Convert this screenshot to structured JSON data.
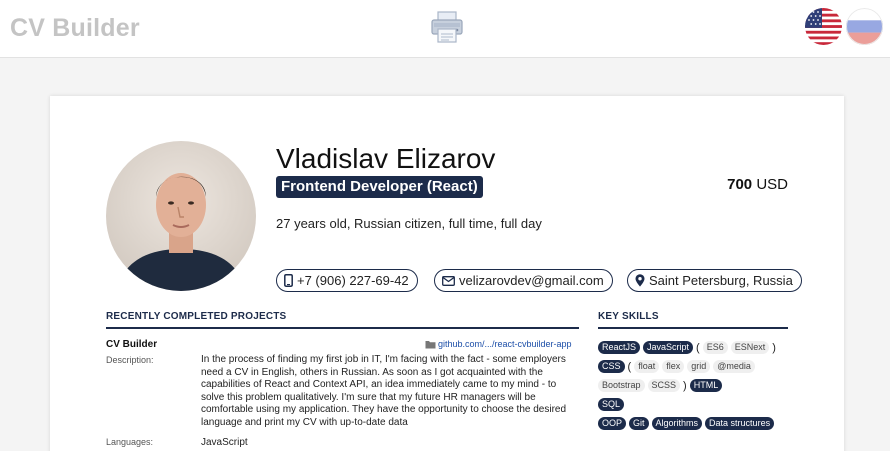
{
  "header": {
    "brand": "CV Builder",
    "print_icon": "printer-icon",
    "languages": [
      {
        "code": "en",
        "icon": "us-flag-icon",
        "active": true
      },
      {
        "code": "ru",
        "icon": "russia-flag-icon",
        "active": false
      }
    ]
  },
  "profile": {
    "name": "Vladislav Elizarov",
    "position": "Frontend Developer (React)",
    "salary_amount": "700",
    "salary_currency": "USD",
    "about": "27 years old, Russian citizen, full time, full day"
  },
  "contacts": {
    "phone": "+7 (906) 227-69-42",
    "email": "velizarovdev@gmail.com",
    "location": "Saint Petersburg, Russia"
  },
  "projects": {
    "title": "RECENTLY COMPLETED PROJECTS",
    "description_label": "Description:",
    "languages_label": "Languages:",
    "items": [
      {
        "name": "CV Builder",
        "link": "github.com/.../react-cvbuilder-app",
        "description": "In the process of finding my first job in IT, I'm facing with the fact - some employers need a CV in English, others in Russian. As soon as I got acquainted with the capabilities of React and Context API, an idea immediately came to my mind - to solve this problem qualitatively. I'm sure that my future HR managers will be comfortable using my application. They have the opportunity to choose the desired language and print my CV with up-to-date data",
        "languages": "JavaScript"
      }
    ]
  },
  "skills": {
    "title": "KEY SKILLS",
    "rows": [
      [
        "ReactJS",
        "JavaScript",
        "(",
        "ES6",
        "ESNext",
        ")"
      ],
      [
        "CSS",
        "(",
        "float",
        "flex",
        "grid",
        "@media"
      ],
      [
        "Bootstrap",
        "SCSS",
        ")",
        "HTML"
      ],
      [
        "SQL"
      ],
      [
        "OOP",
        "Git",
        "Algorithms",
        "Data structures"
      ]
    ],
    "styles": [
      [
        "dark",
        "dark",
        "paren",
        "light",
        "light",
        "paren"
      ],
      [
        "dark",
        "paren",
        "light",
        "light",
        "light",
        "light"
      ],
      [
        "light",
        "light",
        "paren",
        "dark"
      ],
      [
        "dark"
      ],
      [
        "dark",
        "dark",
        "dark",
        "dark"
      ]
    ]
  },
  "colors": {
    "accent": "#1c2b4a",
    "link": "#1d4fa8",
    "brand": "#c4c4c4"
  }
}
